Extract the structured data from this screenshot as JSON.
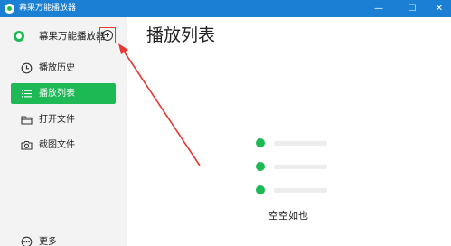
{
  "window": {
    "title": "幕果万能播放器",
    "controls": {
      "minimize": "—",
      "maximize": "☐",
      "close": "✕"
    }
  },
  "sidebar": {
    "brand": {
      "name": "幕果万能播放器",
      "logo_icon": "player-logo-icon",
      "add_icon": "plus-circle-icon"
    },
    "items": [
      {
        "label": "播放历史",
        "icon": "clock-icon",
        "active": false
      },
      {
        "label": "播放列表",
        "icon": "list-icon",
        "active": true
      },
      {
        "label": "打开文件",
        "icon": "folder-icon",
        "active": false
      },
      {
        "label": "截图文件",
        "icon": "camera-icon",
        "active": false
      }
    ],
    "more": {
      "label": "更多",
      "icon": "more-dots-icon"
    }
  },
  "main": {
    "title": "播放列表",
    "empty_state": {
      "text": "空空如也",
      "placeholder_rows": 3
    }
  },
  "colors": {
    "accent": "#1db954",
    "titlebar": "#1b7fd4",
    "annotation": "#e53935",
    "sidebar_bg": "#f3f3f3"
  }
}
